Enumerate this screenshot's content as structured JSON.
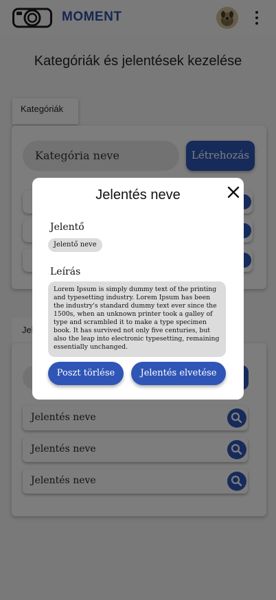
{
  "app": {
    "brand": "MOMENT"
  },
  "page": {
    "title": "Kategóriák és jelentések kezelése"
  },
  "categories": {
    "tab_label": "Kategóriák",
    "name_placeholder": "Kategória neve",
    "create_label": "Létrehozás"
  },
  "reports": {
    "tab_label": "Jelentések",
    "items": [
      {
        "name": "Jelentés neve"
      },
      {
        "name": "Jelentés neve"
      },
      {
        "name": "Jelentés neve"
      }
    ]
  },
  "modal": {
    "title": "Jelentés neve",
    "reporter_label": "Jelentő",
    "reporter_value": "Jelentő neve",
    "description_label": "Leírás",
    "description_text": "Lorem Ipsum is simply dummy text of the printing and typesetting industry. Lorem Ipsum has been the industry's standard dummy text ever since the 1500s, when an unknown printer took a galley of type and scrambled it to make a type specimen book. It has survived not only five centuries, but also the leap into electronic typesetting, remaining essentially unchanged.",
    "delete_post_label": "Poszt törlése",
    "dismiss_label": "Jelentés elvetése"
  },
  "icons": {
    "logo": "camera-logo-icon",
    "menu": "kebab-menu-icon",
    "close": "close-icon",
    "search": "search-icon",
    "remove": "close-icon"
  },
  "colors": {
    "accent": "#2f56b6",
    "brand": "#2a4fa6",
    "chip": "#dcdcdc"
  }
}
